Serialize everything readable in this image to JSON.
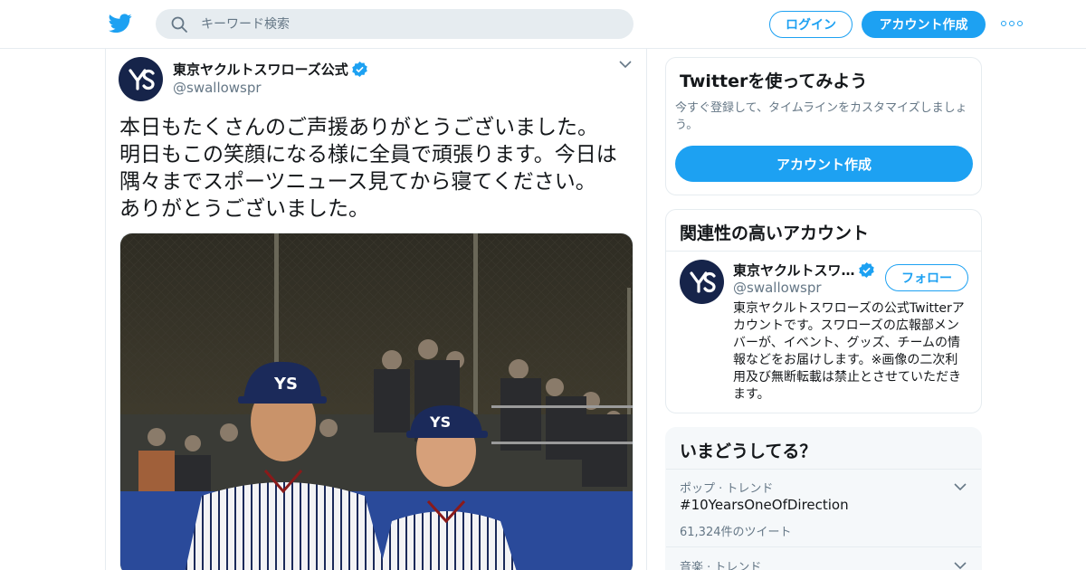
{
  "colors": {
    "accent": "#1da1f2",
    "border": "#e6ecf0",
    "secondary_text": "#657786",
    "navy": "#16244a"
  },
  "header": {
    "logo_icon": "twitter-bird-icon",
    "search_placeholder": "キーワード検索",
    "login_label": "ログイン",
    "signup_label": "アカウント作成",
    "more_icon": "more-dots-icon"
  },
  "tweet": {
    "author_name": "東京ヤクルトスワローズ公式",
    "verified_icon": "verified-badge-icon",
    "handle": "@swallowspr",
    "text": "本日もたくさんのご声援ありがとうございました。\n明日もこの笑顔になる様に全員で頑張ります。今日は\n隅々までスポーツニュース見てから寝てください。\nありがとうございました。",
    "media_icon": "photo-two-baseball-players"
  },
  "signup_card": {
    "title": "Twitterを使ってみよう",
    "subtitle": "今すぐ登録して、タイムラインをカスタマイズしましょう。",
    "cta_label": "アカウント作成"
  },
  "related_card": {
    "title": "関連性の高いアカウント",
    "account": {
      "name": "東京ヤクルトスワ…",
      "handle": "@swallowspr",
      "follow_label": "フォロー",
      "bio": "東京ヤクルトスワローズの公式Twitterアカウントです。スワローズの広報部メンバーが、イベント、グッズ、チームの情報などをお届けします。※画像の二次利用及び無断転載は禁止とさせていただきます。"
    }
  },
  "trends_card": {
    "title": "いまどうしてる？",
    "items": [
      {
        "meta": "ポップ · トレンド",
        "name": "#10YearsOneOfDirection",
        "count": "61,324件のツイート"
      },
      {
        "meta": "音楽 · トレンド"
      }
    ]
  }
}
